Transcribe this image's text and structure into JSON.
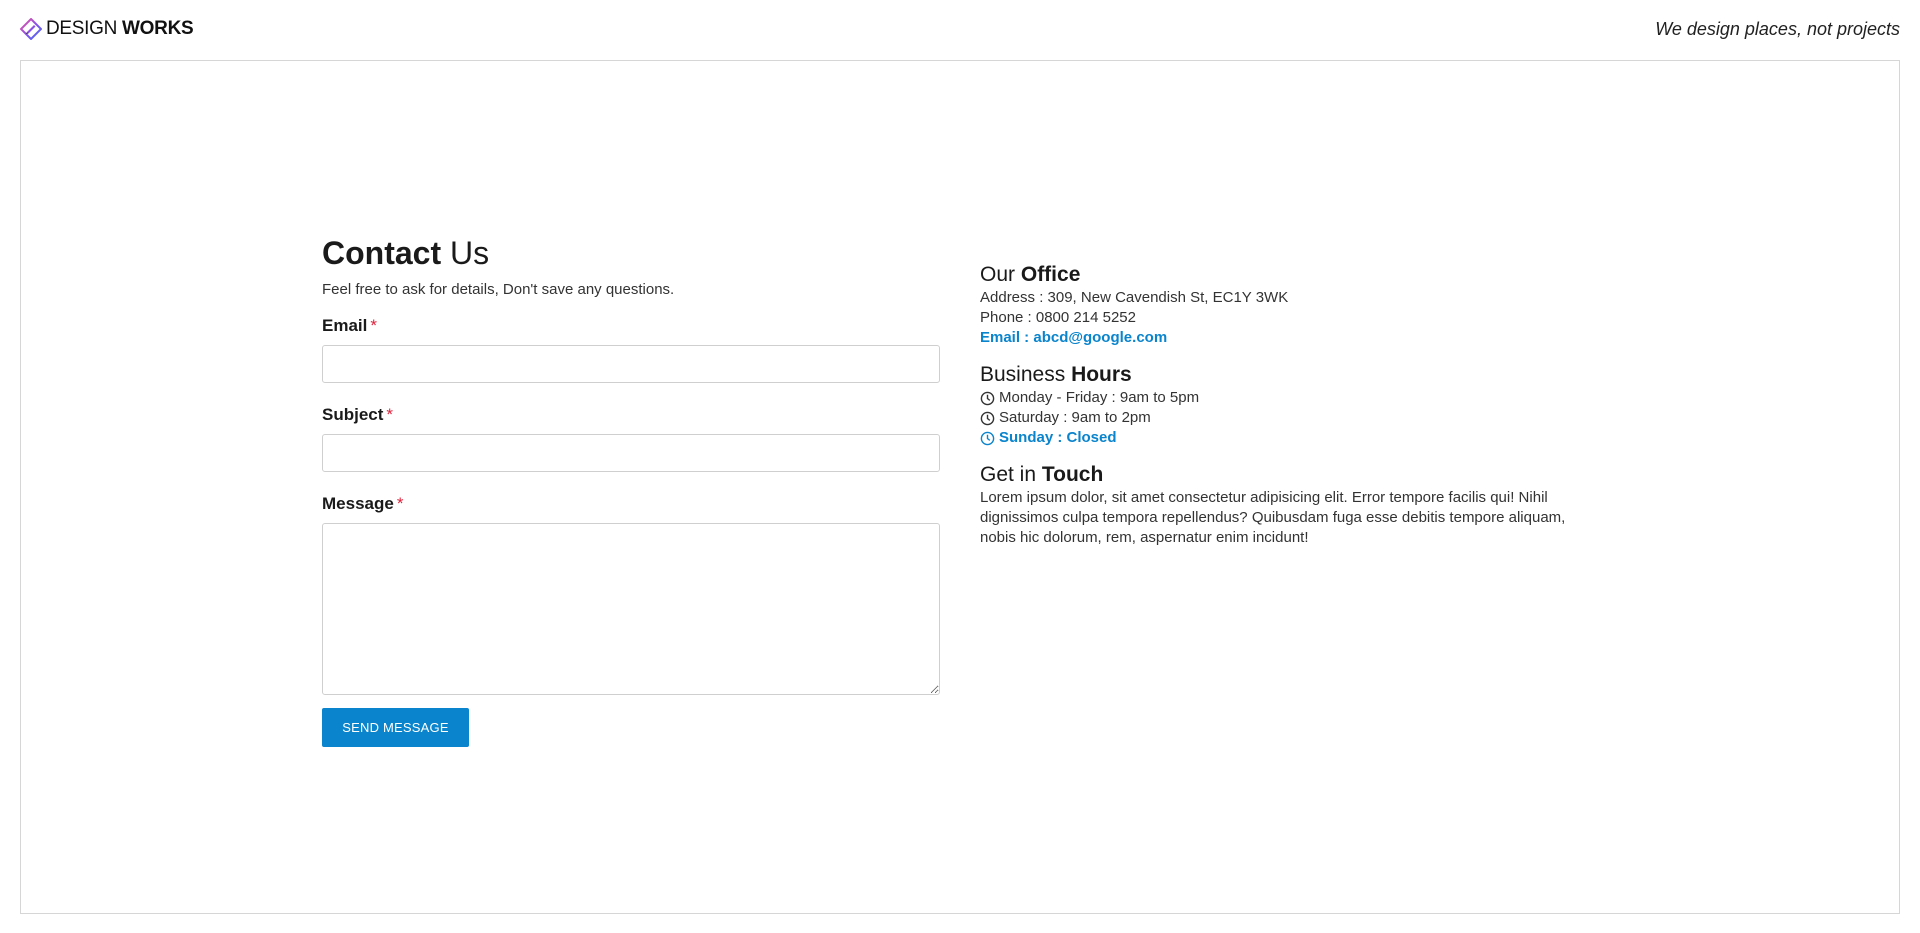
{
  "header": {
    "brand_light": "DESIGN",
    "brand_bold": "WORKS",
    "tagline": "We design places, not projects"
  },
  "contact": {
    "title_bold": "Contact",
    "title_light": "Us",
    "subtitle": "Feel free to ask for details, Don't save any questions.",
    "email_label": "Email",
    "subject_label": "Subject",
    "message_label": "Message",
    "required_mark": "*",
    "email_value": "",
    "subject_value": "",
    "message_value": "",
    "send_label": "SEND MESSAGE"
  },
  "office": {
    "title_light": "Our",
    "title_bold": "Office",
    "address": "Address : 309, New Cavendish St, EC1Y 3WK",
    "phone": "Phone : 0800 214 5252",
    "email": "Email : abcd@google.com"
  },
  "hours": {
    "title_light": "Business",
    "title_bold": "Hours",
    "weekday": "Monday - Friday : 9am to 5pm",
    "saturday": "Saturday : 9am to 2pm",
    "sunday": "Sunday : Closed"
  },
  "touch": {
    "title_light": "Get in",
    "title_bold": "Touch",
    "text": "Lorem ipsum dolor, sit amet consectetur adipisicing elit. Error tempore facilis qui! Nihil dignissimos culpa tempora repellendus? Quibusdam fuga esse debitis tempore aliquam, nobis hic dolorum, rem, aspernatur enim incidunt!"
  },
  "colors": {
    "accent": "#0a84cc",
    "required": "#e0203a",
    "border": "#d6d6d6"
  },
  "icons": {
    "logo": "pen-diamond-logo-icon",
    "clock": "clock-icon"
  }
}
